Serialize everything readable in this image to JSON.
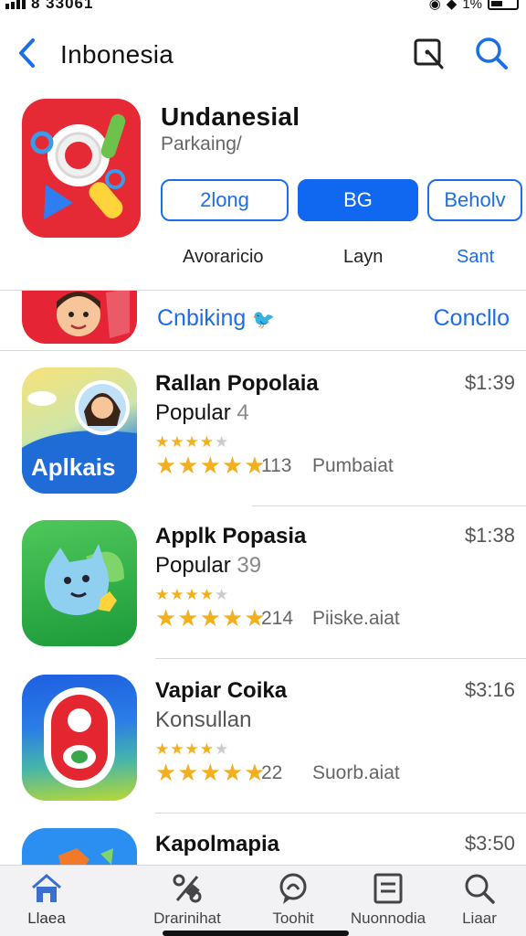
{
  "status_bar": {
    "time": "8 33061"
  },
  "nav": {
    "title": "Inbonesia",
    "back_icon": "chevron-left-icon",
    "compose_icon": "edit-icon",
    "search_icon": "search-icon"
  },
  "header": {
    "app_name": "Undanesial",
    "subtitle": "Parkaing/",
    "buttons": [
      "2long",
      "BG",
      "Beholv"
    ],
    "segments": [
      "Avoraricio",
      "Layn",
      "Sant"
    ]
  },
  "ranking": {
    "label": "Cnbiking",
    "link": "Concllo"
  },
  "apps": [
    {
      "name": "Rallan Popolaia",
      "category": "Popular",
      "category_num": "4",
      "price": "$1:39",
      "count": "113",
      "meta": "Pumbaiat",
      "icon_text": "Aplkais"
    },
    {
      "name": "Applk Popasia",
      "category": "Popular",
      "category_num": "39",
      "price": "$1:38",
      "count": "214",
      "meta": "Piiske.aiat"
    },
    {
      "name": "Vapiar Coika",
      "category": "Konsullan",
      "category_num": "",
      "price": "$3:16",
      "count": "22",
      "meta": "Suorb.aiat"
    },
    {
      "name": "Kapolmapia",
      "category": "",
      "category_num": "",
      "price": "$3:50",
      "count": "",
      "meta": ""
    }
  ],
  "tabs": [
    {
      "label": "Llaea",
      "icon": "home-icon"
    },
    {
      "label": "Drarinihat",
      "icon": "percent-tag-icon"
    },
    {
      "label": "Toohit",
      "icon": "chat-icon"
    },
    {
      "label": "Nuonnodia",
      "icon": "list-icon"
    },
    {
      "label": "Liaar",
      "icon": "search-icon"
    }
  ],
  "colors": {
    "accent": "#1c6ee6",
    "star": "#f2b01e",
    "red_icon": "#e52a36"
  }
}
